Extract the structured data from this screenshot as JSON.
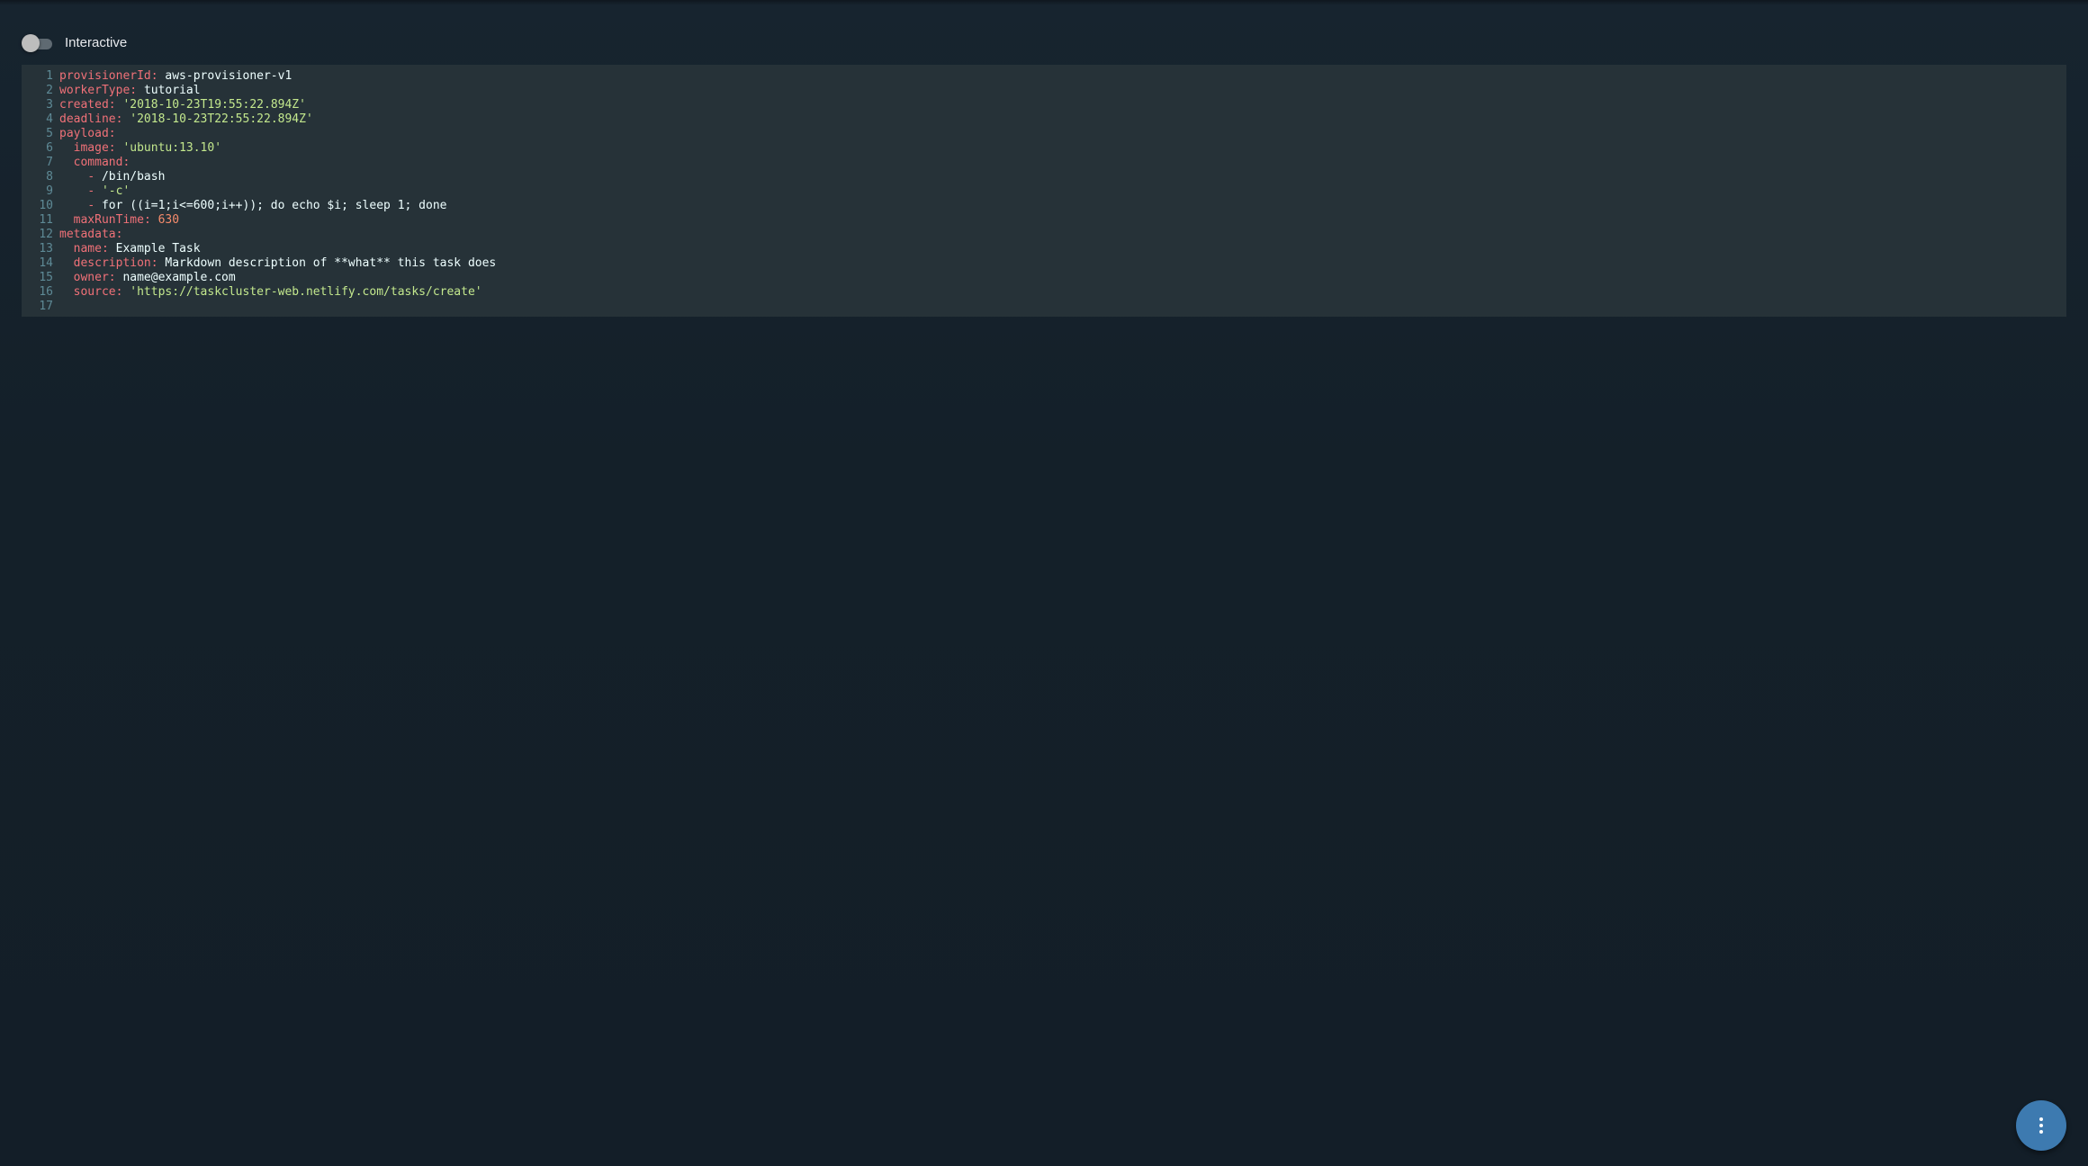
{
  "toolbar": {
    "interactive_label": "Interactive",
    "interactive_on": false
  },
  "editor": {
    "lines": [
      {
        "num": "1",
        "indent": "",
        "key": "provisionerId",
        "value": "aws-provisioner-v1",
        "type": "plain"
      },
      {
        "num": "2",
        "indent": "",
        "key": "workerType",
        "value": "tutorial",
        "type": "plain"
      },
      {
        "num": "3",
        "indent": "",
        "key": "created",
        "value": "'2018-10-23T19:55:22.894Z'",
        "type": "string"
      },
      {
        "num": "4",
        "indent": "",
        "key": "deadline",
        "value": "'2018-10-23T22:55:22.894Z'",
        "type": "string"
      },
      {
        "num": "5",
        "indent": "",
        "key": "payload",
        "value": "",
        "type": "plain"
      },
      {
        "num": "6",
        "indent": "  ",
        "key": "image",
        "value": "'ubuntu:13.10'",
        "type": "string"
      },
      {
        "num": "7",
        "indent": "  ",
        "key": "command",
        "value": "",
        "type": "plain"
      },
      {
        "num": "8",
        "indent": "    ",
        "item": "/bin/bash",
        "type": "plain"
      },
      {
        "num": "9",
        "indent": "    ",
        "item": "'-c'",
        "type": "string"
      },
      {
        "num": "10",
        "indent": "    ",
        "item": "for ((i=1;i<=600;i++)); do echo $i; sleep 1; done",
        "type": "plain"
      },
      {
        "num": "11",
        "indent": "  ",
        "key": "maxRunTime",
        "value": "630",
        "type": "number"
      },
      {
        "num": "12",
        "indent": "",
        "key": "metadata",
        "value": "",
        "type": "plain"
      },
      {
        "num": "13",
        "indent": "  ",
        "key": "name",
        "value": "Example Task",
        "type": "plain"
      },
      {
        "num": "14",
        "indent": "  ",
        "key": "description",
        "value": "Markdown description of **what** this task does",
        "type": "plain"
      },
      {
        "num": "15",
        "indent": "  ",
        "key": "owner",
        "value": "name@example.com",
        "type": "plain"
      },
      {
        "num": "16",
        "indent": "  ",
        "key": "source",
        "value": "'https://taskcluster-web.netlify.com/tasks/create'",
        "type": "string"
      },
      {
        "num": "17",
        "indent": "",
        "type": "empty"
      }
    ]
  },
  "fab": {
    "icon": "more-vertical-icon"
  },
  "colors": {
    "background": "#14202b",
    "editor_background": "#263238",
    "key": "#f07178",
    "string": "#c3e88d",
    "number": "#f78c6c",
    "line_number": "#5e8a96",
    "fab": "#3d7ab0"
  }
}
